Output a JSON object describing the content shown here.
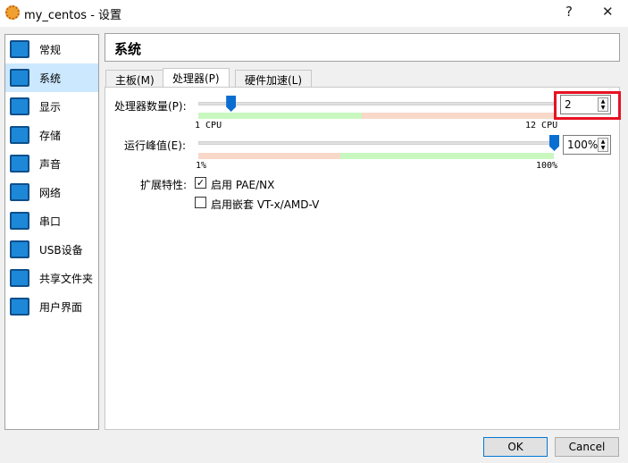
{
  "window": {
    "title": "my_centos - 设置",
    "help": "?",
    "close": "✕"
  },
  "sidebar": {
    "items": [
      {
        "label": "常规",
        "icon": "general-icon"
      },
      {
        "label": "系统",
        "icon": "system-icon",
        "selected": true
      },
      {
        "label": "显示",
        "icon": "display-icon"
      },
      {
        "label": "存储",
        "icon": "storage-icon"
      },
      {
        "label": "声音",
        "icon": "audio-icon"
      },
      {
        "label": "网络",
        "icon": "network-icon"
      },
      {
        "label": "串口",
        "icon": "serial-port-icon"
      },
      {
        "label": "USB设备",
        "icon": "usb-icon"
      },
      {
        "label": "共享文件夹",
        "icon": "shared-folder-icon"
      },
      {
        "label": "用户界面",
        "icon": "user-interface-icon"
      }
    ]
  },
  "header": {
    "title": "系统"
  },
  "tabs": [
    {
      "label": "主板(M)"
    },
    {
      "label": "处理器(P)",
      "active": true
    },
    {
      "label": "硬件加速(L)"
    }
  ],
  "processor": {
    "cpu_label": "处理器数量(P):",
    "cpu_value": "2",
    "cpu_min": "1 CPU",
    "cpu_max": "12 CPU",
    "cpu_count": 2,
    "cpu_range": [
      1,
      12
    ],
    "cap_label": "运行峰值(E):",
    "cap_value": "100%",
    "cap_min": "1%",
    "cap_max": "100%",
    "cap_percent": 100,
    "ext_label": "扩展特性:",
    "pae_label": "启用 PAE/NX",
    "pae_checked": true,
    "vtx_label": "启用嵌套 VT-x/AMD-V",
    "vtx_checked": false
  },
  "buttons": {
    "ok": "OK",
    "cancel": "Cancel"
  },
  "colors": {
    "highlight": "#e81123",
    "green": "#c8f8c0",
    "red": "#f8d8c8",
    "accent": "#0a6ed1"
  }
}
